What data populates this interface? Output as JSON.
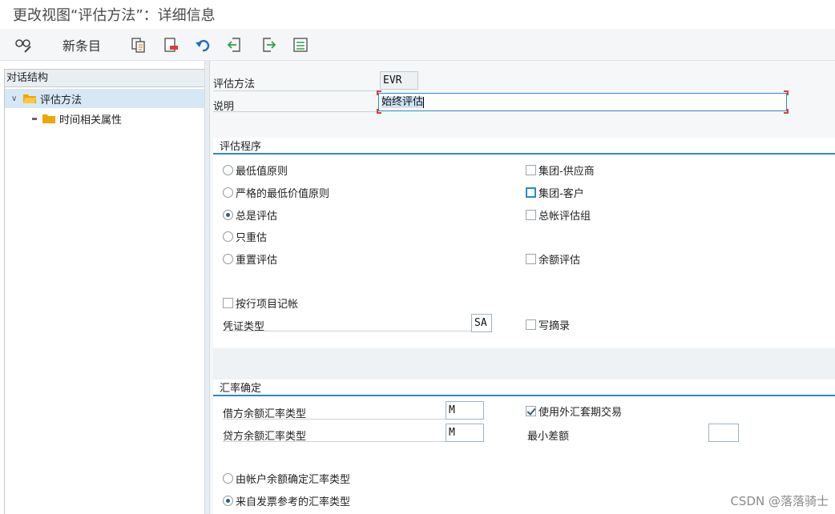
{
  "window": {
    "title": "更改视图“评估方法”：详细信息"
  },
  "toolbar": {
    "new_entries_label": "新条目",
    "icons": [
      "glasses-edit-icon",
      "copy-icon",
      "delete-icon",
      "undo-icon",
      "previous-entry-icon",
      "next-entry-icon",
      "select-all-icon"
    ]
  },
  "tree": {
    "header": "对话结构",
    "items": [
      {
        "label": "评估方法",
        "selected": true
      },
      {
        "label": "时间相关属性",
        "selected": false
      }
    ]
  },
  "form": {
    "method_label": "评估方法",
    "method_value": "EVR",
    "desc_label": "说明",
    "desc_value": "始终评估"
  },
  "procedure": {
    "title": "评估程序",
    "radios": [
      {
        "label": "最低值原则",
        "checked": false
      },
      {
        "label": "严格的最低价值原则",
        "checked": false
      },
      {
        "label": "总是评估",
        "checked": true
      },
      {
        "label": "只重估",
        "checked": false
      },
      {
        "label": "重置评估",
        "checked": false
      }
    ],
    "checks": [
      {
        "label": "集团-供应商",
        "checked": false
      },
      {
        "label": "集团-客户",
        "checked": false
      },
      {
        "label": "总帐评估组",
        "checked": false
      },
      {
        "label": "余额评估",
        "checked": false
      }
    ],
    "line_item_label": "按行项目记帐",
    "doc_type_label": "凭证类型",
    "doc_type_value": "SA",
    "write_extract_label": "写摘录"
  },
  "exchange": {
    "title": "汇率确定",
    "debit_label": "借方余额汇率类型",
    "debit_value": "M",
    "credit_label": "贷方余额汇率类型",
    "credit_value": "M",
    "hedge_label": "使用外汇套期交易",
    "hedge_checked": true,
    "min_diff_label": "最小差额",
    "min_diff_value": "",
    "radio_account": "由帐户余额确定汇率类型",
    "radio_invoice": "来自发票参考的汇率类型",
    "invoice_checked": true
  },
  "watermark": "CSDN @落落骑士",
  "colors": {
    "accent": "#2a8ac8",
    "folder": "#f0a500",
    "selected_bg": "#d6e8f5"
  }
}
